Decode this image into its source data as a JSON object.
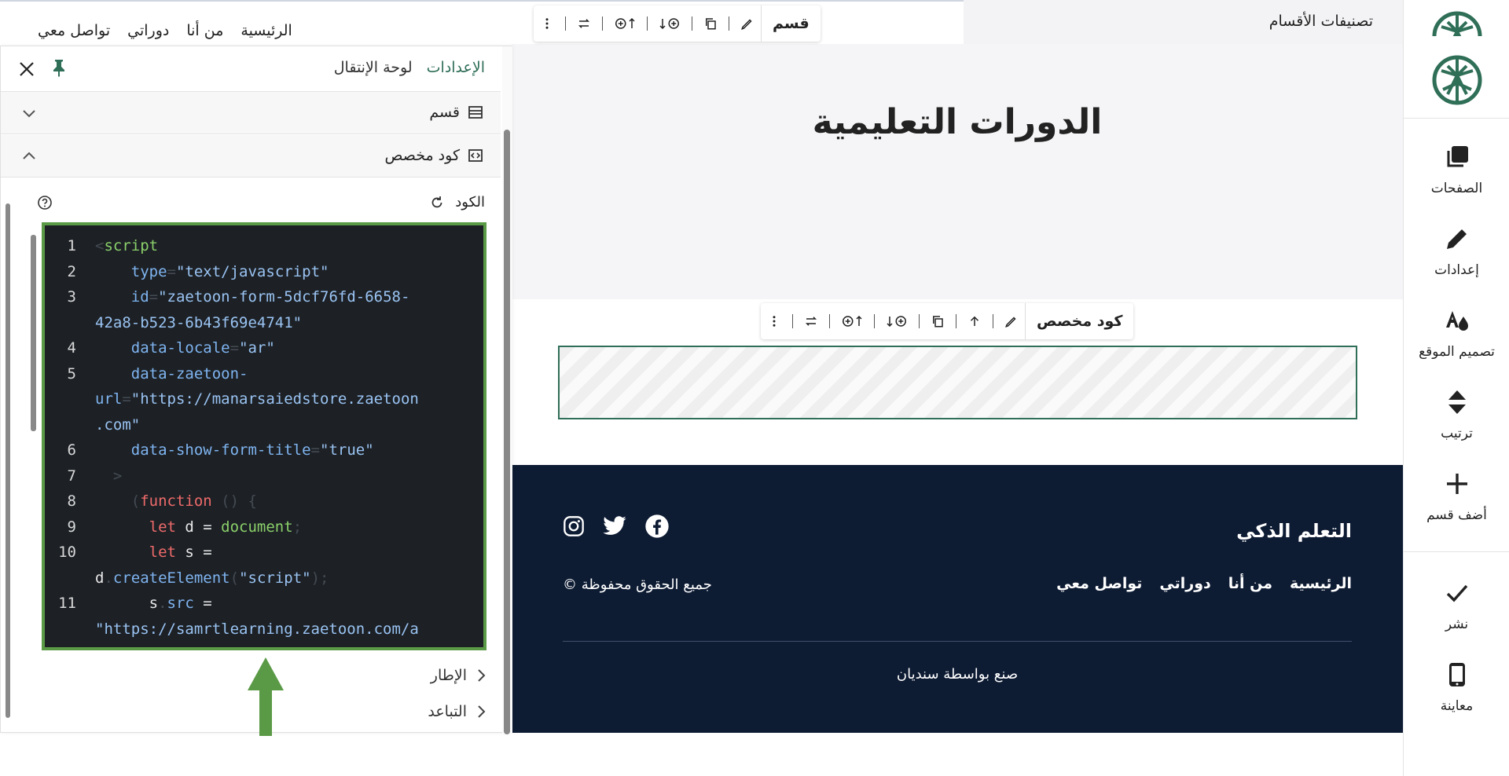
{
  "sidebar": {
    "items": [
      {
        "label": "الصفحات",
        "icon": "pages-icon"
      },
      {
        "label": "إعدادات",
        "icon": "pencil-icon"
      },
      {
        "label": "تصميم الموقع",
        "icon": "design-icon"
      },
      {
        "label": "ترتيب",
        "icon": "reorder-icon"
      },
      {
        "label": "أضف قسم",
        "icon": "plus-icon"
      },
      {
        "label": "نشر",
        "icon": "check-icon"
      },
      {
        "label": "معاينة",
        "icon": "mobile-icon"
      }
    ]
  },
  "topbar": {
    "title": "تصنيفات الأقسام"
  },
  "site_nav": {
    "items": [
      "الرئيسية",
      "من أنا",
      "دوراتي",
      "تواصل معي"
    ]
  },
  "section_toolbar": {
    "label": "قسم"
  },
  "block_toolbar": {
    "label": "كود مخصص"
  },
  "hero": {
    "title": "الدورات التعليمية"
  },
  "footer": {
    "brand": "التعلم الذكي",
    "links": [
      "الرئيسية",
      "من أنا",
      "دوراتي",
      "تواصل معي"
    ],
    "copyright": "جميع الحقوق محفوظة ©",
    "credit": "صنع بواسطة سنديان"
  },
  "panel": {
    "tabs": {
      "settings": "الإعدادات",
      "navigator": "لوحة الإنتقال"
    },
    "rows": {
      "section": "قسم",
      "custom_code": "كود مخصص"
    },
    "code_label": "الكود",
    "frame_label": "الإطار",
    "spacing_label": "التباعد"
  },
  "code_lines": [
    {
      "n": "1",
      "parts": [
        [
          "c-punc",
          "<"
        ],
        [
          "c-tag",
          "script"
        ]
      ]
    },
    {
      "n": "2",
      "parts": [
        [
          "c-pl",
          "    "
        ],
        [
          "c-attr",
          "type"
        ],
        [
          "c-punc",
          "="
        ],
        [
          "c-str",
          "\"text/javascript\""
        ]
      ]
    },
    {
      "n": "3",
      "parts": [
        [
          "c-pl",
          "    "
        ],
        [
          "c-attr",
          "id"
        ],
        [
          "c-punc",
          "="
        ],
        [
          "c-str",
          "\"zaetoon-form-5dcf76fd-6658-"
        ]
      ]
    },
    {
      "n": "",
      "parts": [
        [
          "c-str",
          "42a8-b523-6b43f69e4741\""
        ]
      ]
    },
    {
      "n": "4",
      "parts": [
        [
          "c-pl",
          "    "
        ],
        [
          "c-attr",
          "data-locale"
        ],
        [
          "c-punc",
          "="
        ],
        [
          "c-str",
          "\"ar\""
        ]
      ]
    },
    {
      "n": "5",
      "parts": [
        [
          "c-pl",
          "    "
        ],
        [
          "c-attr",
          "data-zaetoon-"
        ]
      ]
    },
    {
      "n": "",
      "parts": [
        [
          "c-attr",
          "url"
        ],
        [
          "c-punc",
          "="
        ],
        [
          "c-str",
          "\"https://manarsaiedstore.zaetoon"
        ]
      ]
    },
    {
      "n": "",
      "parts": [
        [
          "c-str",
          ".com\""
        ]
      ]
    },
    {
      "n": "6",
      "parts": [
        [
          "c-pl",
          "    "
        ],
        [
          "c-attr",
          "data-show-form-title"
        ],
        [
          "c-punc",
          "="
        ],
        [
          "c-str",
          "\"true\""
        ]
      ]
    },
    {
      "n": "7",
      "parts": [
        [
          "c-pl",
          "  "
        ],
        [
          "c-punc",
          ">"
        ]
      ]
    },
    {
      "n": "8",
      "parts": [
        [
          "c-pl",
          "    "
        ],
        [
          "c-punc",
          "("
        ],
        [
          "c-kw",
          "function"
        ],
        [
          "c-punc",
          " () {"
        ]
      ]
    },
    {
      "n": "9",
      "parts": [
        [
          "c-pl",
          "      "
        ],
        [
          "c-kw",
          "let"
        ],
        [
          "c-pl",
          " d = "
        ],
        [
          "c-fn",
          "document"
        ],
        [
          "c-punc",
          ";"
        ]
      ]
    },
    {
      "n": "10",
      "parts": [
        [
          "c-pl",
          "      "
        ],
        [
          "c-kw",
          "let"
        ],
        [
          "c-pl",
          " s ="
        ]
      ]
    },
    {
      "n": "",
      "parts": [
        [
          "c-pl",
          "d"
        ],
        [
          "c-punc",
          "."
        ],
        [
          "c-attr",
          "createElement"
        ],
        [
          "c-punc",
          "("
        ],
        [
          "c-str",
          "\"script\""
        ],
        [
          "c-punc",
          ");"
        ]
      ]
    },
    {
      "n": "11",
      "parts": [
        [
          "c-pl",
          "      s"
        ],
        [
          "c-punc",
          "."
        ],
        [
          "c-attr",
          "src"
        ],
        [
          "c-pl",
          " ="
        ]
      ]
    },
    {
      "n": "",
      "parts": [
        [
          "c-str",
          "\"https://samrtlearning.zaetoon.com/a"
        ]
      ]
    }
  ],
  "colors": {
    "accent": "#2f6e57",
    "footer_bg": "#0d1b33",
    "highlight": "#5a9a46"
  }
}
